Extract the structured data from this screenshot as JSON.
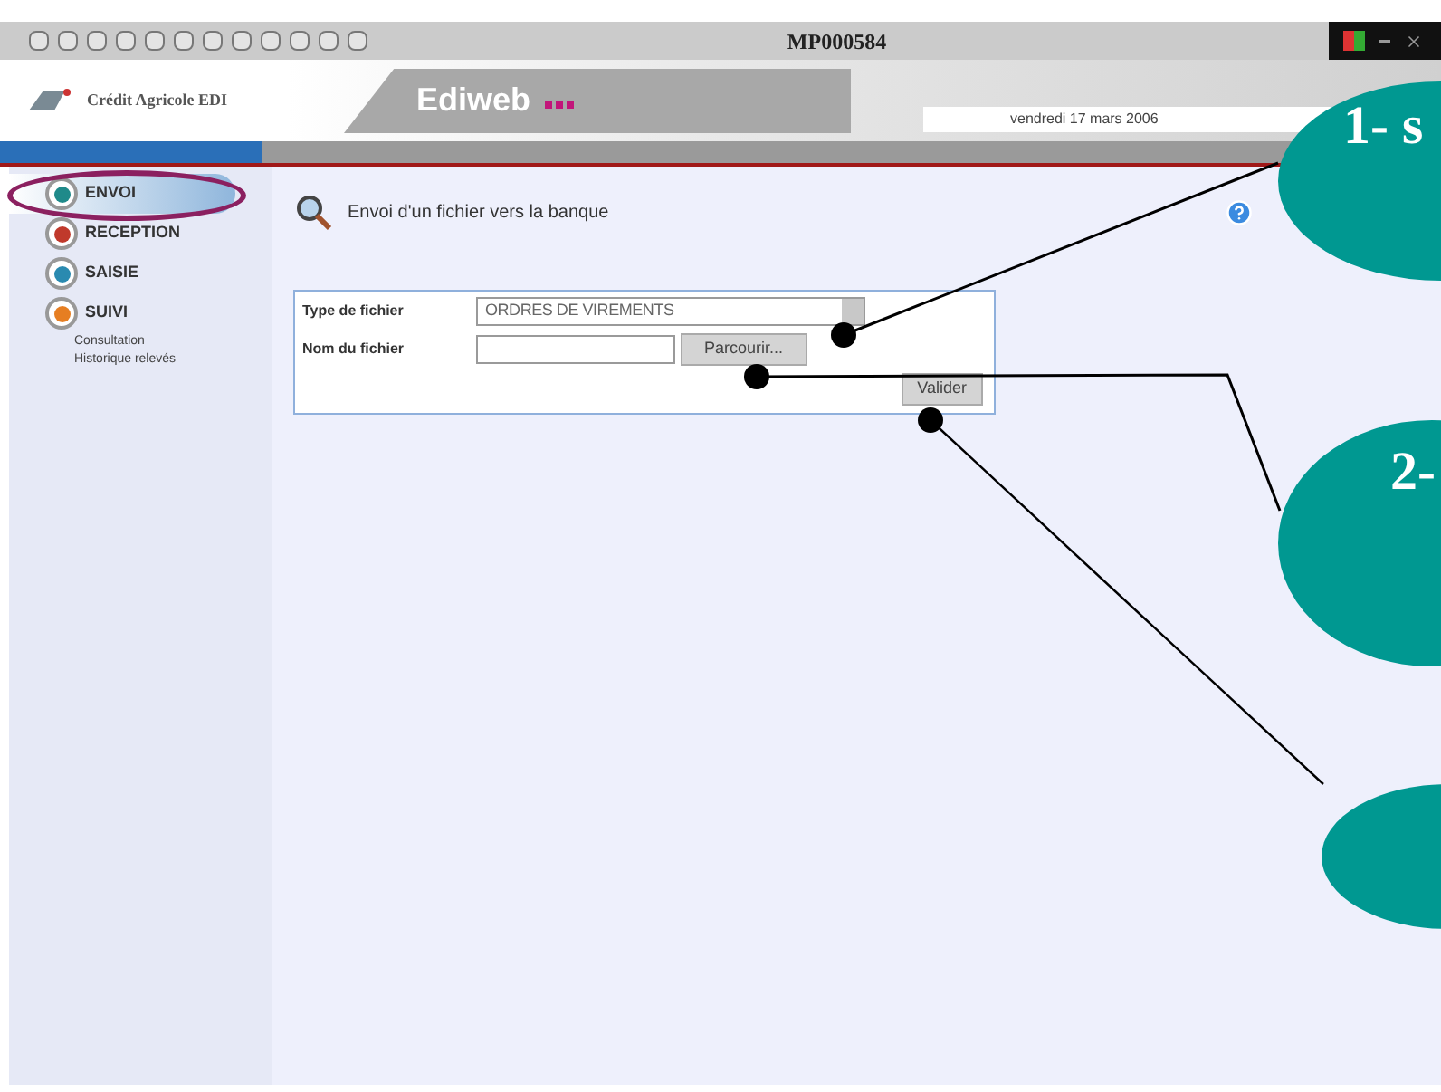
{
  "browser": {
    "title": "MP000584"
  },
  "header": {
    "brand": "Crédit Agricole EDI",
    "app_name": "Ediweb",
    "date": "vendredi 17 mars 2006"
  },
  "sidebar": {
    "items": [
      {
        "label": "ENVOI",
        "selected": true
      },
      {
        "label": "RECEPTION",
        "selected": false
      },
      {
        "label": "SAISIE",
        "selected": false
      },
      {
        "label": "SUIVI",
        "selected": false
      }
    ],
    "links": [
      "Consultation",
      "Historique relevés"
    ]
  },
  "page": {
    "title": "Envoi d'un fichier vers la banque"
  },
  "form": {
    "fields": [
      {
        "kind": "select",
        "label": "Type de fichier",
        "value": "ORDRES DE VIREMENTS"
      },
      {
        "kind": "file",
        "label": "Nom du fichier",
        "button": "Parcourir..."
      }
    ],
    "submit": "Valider"
  },
  "callouts": [
    {
      "kind": "labeled",
      "text": "1- s"
    },
    {
      "kind": "labeled",
      "text": "2-"
    },
    {
      "kind": "blank"
    }
  ]
}
